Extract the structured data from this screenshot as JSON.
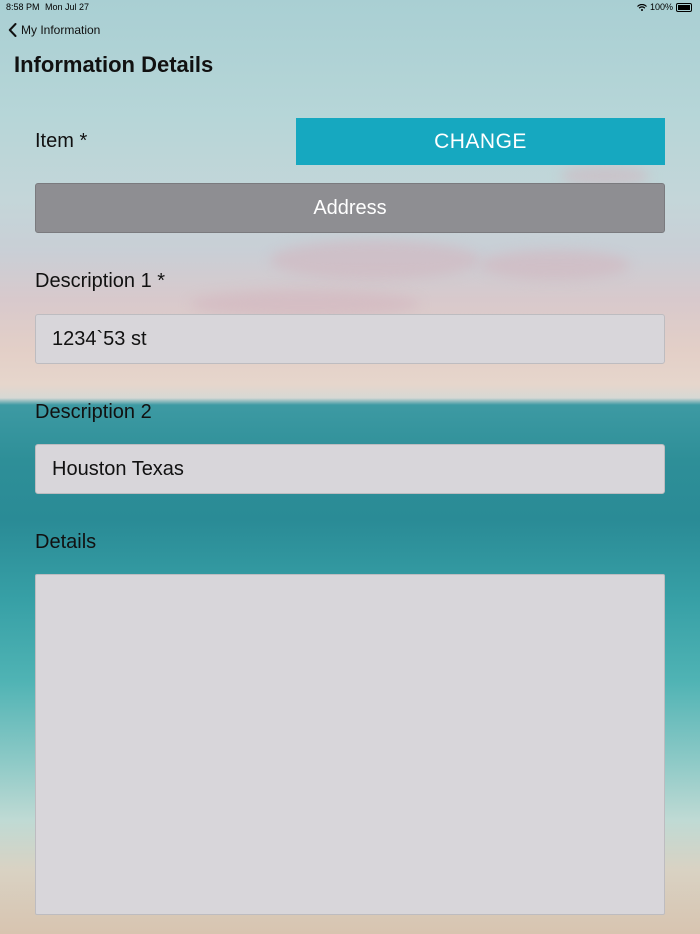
{
  "status_bar": {
    "time": "8:58 PM",
    "date": "Mon Jul 27",
    "battery": "100%"
  },
  "nav": {
    "back_label": "My Information",
    "title": "Information Details"
  },
  "form": {
    "item_label": "Item *",
    "change_label": "CHANGE",
    "item_value": "Address",
    "description1_label": "Description 1 *",
    "description1_value": "1234`53 st",
    "description2_label": "Description 2",
    "description2_value": "Houston Texas",
    "details_label": "Details",
    "details_value": ""
  },
  "colors": {
    "accent": "#16a8c0",
    "item_button": "#8e8e92",
    "field_bg": "#d8d6da"
  }
}
